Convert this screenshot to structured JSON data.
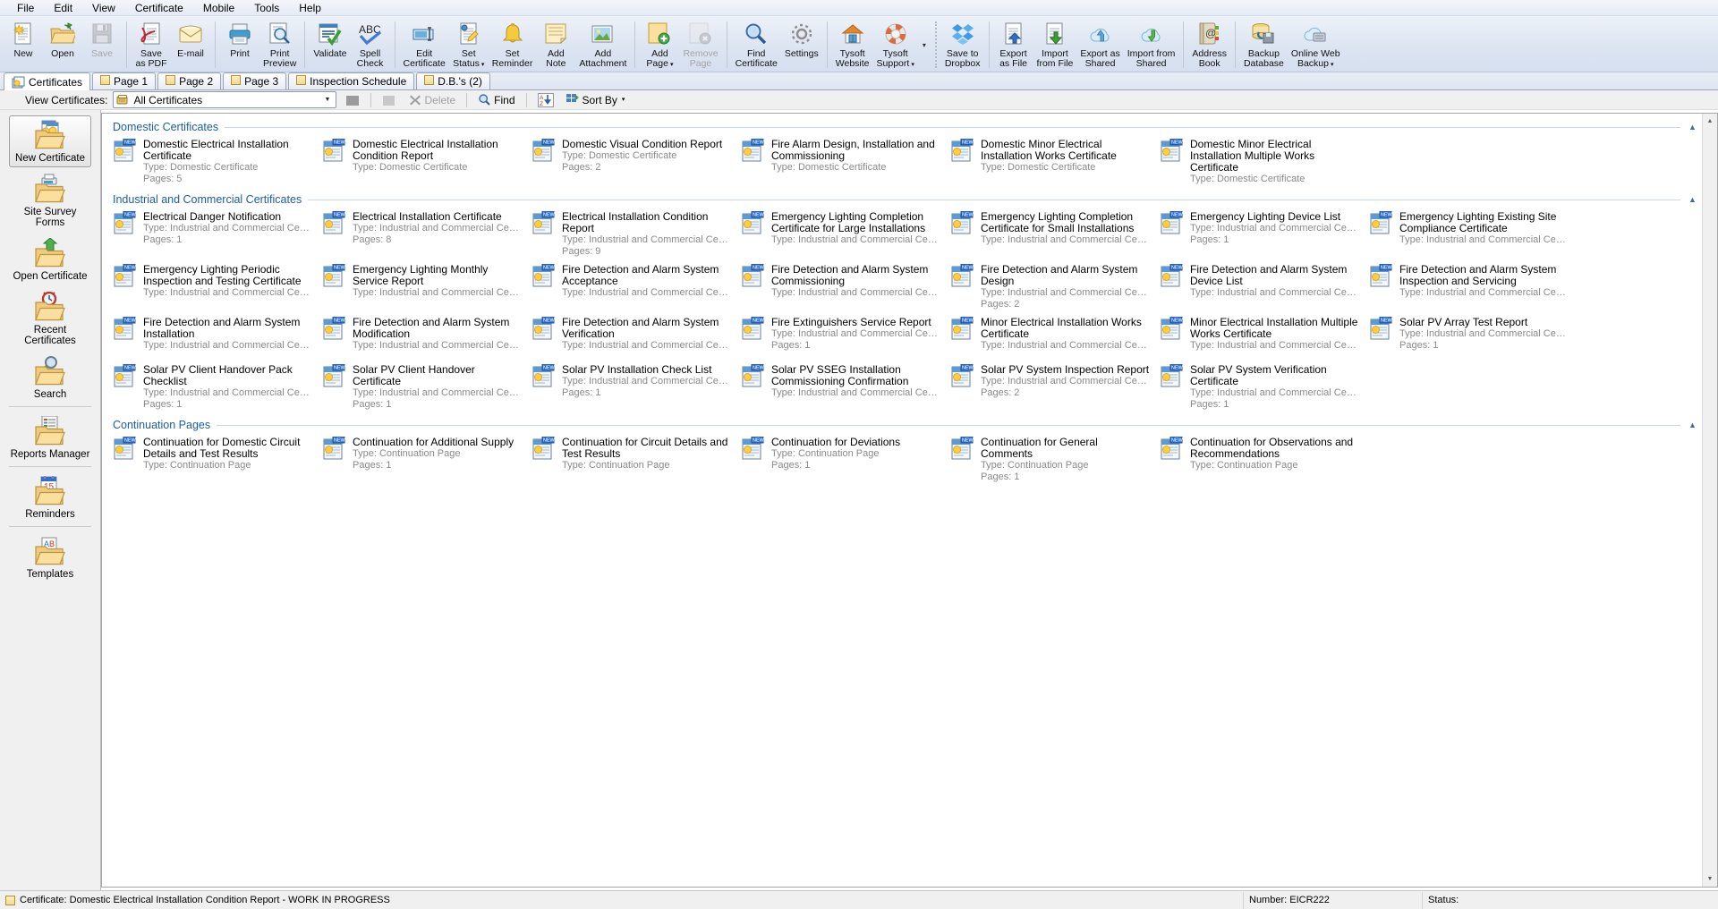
{
  "menu": {
    "items": [
      "File",
      "Edit",
      "View",
      "Certificate",
      "Mobile",
      "Tools",
      "Help"
    ]
  },
  "toolbar": {
    "groups": [
      {
        "buttons": [
          {
            "label": "New",
            "icon": "new-document-icon",
            "disabled": false,
            "dropdown": false
          },
          {
            "label": "Open",
            "icon": "open-folder-icon",
            "disabled": false,
            "dropdown": false
          },
          {
            "label": "Save",
            "icon": "floppy-save-icon",
            "disabled": true,
            "dropdown": false
          }
        ]
      },
      {
        "buttons": [
          {
            "label": "Save\nas PDF",
            "icon": "pdf-icon",
            "disabled": false,
            "dropdown": false
          },
          {
            "label": "E-mail",
            "icon": "envelope-icon",
            "disabled": false,
            "dropdown": false
          }
        ]
      },
      {
        "buttons": [
          {
            "label": "Print",
            "icon": "printer-icon",
            "disabled": false,
            "dropdown": false
          },
          {
            "label": "Print\nPreview",
            "icon": "print-preview-icon",
            "disabled": false,
            "dropdown": false
          }
        ]
      },
      {
        "buttons": [
          {
            "label": "Validate",
            "icon": "validate-checkmark-icon",
            "disabled": false,
            "dropdown": false
          },
          {
            "label": "Spell\nCheck",
            "icon": "spellcheck-abc-icon",
            "disabled": false,
            "dropdown": false
          }
        ]
      },
      {
        "buttons": [
          {
            "label": "Edit\nCertificate",
            "icon": "edit-certificate-icon",
            "disabled": false,
            "dropdown": false
          },
          {
            "label": "Set\nStatus",
            "icon": "set-status-icon",
            "disabled": false,
            "dropdown": true
          },
          {
            "label": "Set\nReminder",
            "icon": "bell-reminder-icon",
            "disabled": false,
            "dropdown": false
          },
          {
            "label": "Add\nNote",
            "icon": "note-icon",
            "disabled": false,
            "dropdown": false
          },
          {
            "label": "Add\nAttachment",
            "icon": "attachment-image-icon",
            "disabled": false,
            "dropdown": false
          }
        ]
      },
      {
        "buttons": [
          {
            "label": "Add\nPage",
            "icon": "add-page-icon",
            "disabled": false,
            "dropdown": true
          },
          {
            "label": "Remove\nPage",
            "icon": "remove-page-icon",
            "disabled": true,
            "dropdown": false
          }
        ]
      },
      {
        "buttons": [
          {
            "label": "Find\nCertificate",
            "icon": "magnifier-icon",
            "disabled": false,
            "dropdown": false
          },
          {
            "label": "Settings",
            "icon": "gear-icon",
            "disabled": false,
            "dropdown": false
          }
        ]
      },
      {
        "buttons": [
          {
            "label": "Tysoft\nWebsite",
            "icon": "home-icon",
            "disabled": false,
            "dropdown": false
          },
          {
            "label": "Tysoft\nSupport",
            "icon": "lifebuoy-icon",
            "disabled": false,
            "dropdown": true
          }
        ]
      },
      {
        "buttons": [
          {
            "label": "Save to\nDropbox",
            "icon": "dropbox-icon",
            "disabled": false,
            "dropdown": false
          }
        ]
      },
      {
        "buttons": [
          {
            "label": "Export\nas File",
            "icon": "export-file-icon",
            "disabled": false,
            "dropdown": false
          },
          {
            "label": "Import\nfrom File",
            "icon": "import-file-icon",
            "disabled": false,
            "dropdown": false
          },
          {
            "label": "Export as\nShared",
            "icon": "cloud-upload-icon",
            "disabled": false,
            "dropdown": false
          },
          {
            "label": "Import from\nShared",
            "icon": "cloud-download-icon",
            "disabled": false,
            "dropdown": false
          }
        ]
      },
      {
        "buttons": [
          {
            "label": "Address\nBook",
            "icon": "address-book-icon",
            "disabled": false,
            "dropdown": false
          }
        ]
      },
      {
        "buttons": [
          {
            "label": "Backup\nDatabase",
            "icon": "backup-database-icon",
            "disabled": false,
            "dropdown": false
          },
          {
            "label": "Online Web\nBackup",
            "icon": "online-backup-icon",
            "disabled": false,
            "dropdown": true
          }
        ]
      }
    ],
    "overflow_caret": "▾"
  },
  "tabs": [
    {
      "label": "Certificates",
      "active": true,
      "icon": "certificates-tab-icon"
    },
    {
      "label": "Page 1",
      "active": false,
      "icon": "page-tab-icon"
    },
    {
      "label": "Page 2",
      "active": false,
      "icon": "page-tab-icon"
    },
    {
      "label": "Page 3",
      "active": false,
      "icon": "page-tab-icon"
    },
    {
      "label": "Inspection Schedule",
      "active": false,
      "icon": "page-tab-icon"
    },
    {
      "label": "D.B.'s (2)",
      "active": false,
      "icon": "page-tab-icon"
    }
  ],
  "filterbar": {
    "view_label": "View Certificates:",
    "combo_value": "All Certificates",
    "combo_icon": "card-index-icon",
    "combo_arrow": "▼",
    "new_folder_label": "",
    "open_folder_label": "",
    "delete_label": "Delete",
    "find_label": "Find",
    "sort_label": "Sort By",
    "sort_caret": "▾"
  },
  "sidebar": {
    "items": [
      {
        "label": "New Certificate",
        "icon": "new-certificate-folder-icon",
        "selected": true,
        "sep_after": false
      },
      {
        "label": "Site Survey Forms",
        "icon": "site-survey-folder-icon",
        "selected": false,
        "sep_after": false
      },
      {
        "label": "Open Certificate",
        "icon": "open-certificate-folder-icon",
        "selected": false,
        "sep_after": false
      },
      {
        "label": "Recent Certificates",
        "icon": "recent-certificates-folder-icon",
        "selected": false,
        "sep_after": false
      },
      {
        "label": "Search",
        "icon": "search-folder-icon",
        "selected": false,
        "sep_after": true
      },
      {
        "label": "Reports Manager",
        "icon": "reports-manager-folder-icon",
        "selected": false,
        "sep_after": true
      },
      {
        "label": "Reminders",
        "icon": "reminders-folder-icon",
        "selected": false,
        "sep_after": true
      },
      {
        "label": "Templates",
        "icon": "templates-folder-icon",
        "selected": false,
        "sep_after": false
      }
    ]
  },
  "content": {
    "groups": [
      {
        "title": "Domestic Certificates",
        "collapse_icon": "▲",
        "items": [
          {
            "title": "Domestic Electrical Installation Certificate",
            "type": "Type: Domestic Certificate",
            "pages": "Pages: 5"
          },
          {
            "title": "Domestic Electrical Installation Condition Report",
            "type": "Type: Domestic Certificate",
            "pages": ""
          },
          {
            "title": "Domestic Visual Condition Report",
            "type": "Type: Domestic Certificate",
            "pages": "Pages: 2"
          },
          {
            "title": "Fire Alarm Design, Installation and Commissioning",
            "type": "Type: Domestic Certificate",
            "pages": ""
          },
          {
            "title": "Domestic Minor Electrical Installation Works Certificate",
            "type": "Type: Domestic Certificate",
            "pages": ""
          },
          {
            "title": "Domestic Minor Electrical Installation Multiple Works Certificate",
            "type": "Type: Domestic Certificate",
            "pages": ""
          }
        ]
      },
      {
        "title": "Industrial and Commercial Certificates",
        "collapse_icon": "▲",
        "items": [
          {
            "title": "Electrical Danger Notification",
            "type": "Type: Industrial and Commercial Certific...",
            "pages": "Pages: 1"
          },
          {
            "title": "Electrical Installation Certificate",
            "type": "Type: Industrial and Commercial Certific...",
            "pages": "Pages: 8"
          },
          {
            "title": "Electrical Installation Condition Report",
            "type": "Type: Industrial and Commercial Certific...",
            "pages": "Pages: 9"
          },
          {
            "title": "Emergency Lighting Completion Certificate for Large Installations",
            "type": "Type: Industrial and Commercial Certific...",
            "pages": ""
          },
          {
            "title": "Emergency Lighting Completion Certificate for Small Installations",
            "type": "Type: Industrial and Commercial Certific...",
            "pages": ""
          },
          {
            "title": "Emergency Lighting Device List",
            "type": "Type: Industrial and Commercial Certific...",
            "pages": "Pages: 1"
          },
          {
            "title": "Emergency Lighting Existing Site Compliance Certificate",
            "type": "Type: Industrial and Commercial Certific...",
            "pages": ""
          },
          {
            "title": "Emergency Lighting Periodic Inspection and Testing Certificate",
            "type": "Type: Industrial and Commercial Certific...",
            "pages": ""
          },
          {
            "title": "Emergency Lighting Monthly Service Report",
            "type": "Type: Industrial and Commercial Certific...",
            "pages": ""
          },
          {
            "title": "Fire Detection and Alarm System Acceptance",
            "type": "Type: Industrial and Commercial Certific...",
            "pages": ""
          },
          {
            "title": "Fire Detection and Alarm System Commissioning",
            "type": "Type: Industrial and Commercial Certific...",
            "pages": ""
          },
          {
            "title": "Fire Detection and Alarm System Design",
            "type": "Type: Industrial and Commercial Certific...",
            "pages": "Pages: 2"
          },
          {
            "title": "Fire Detection and Alarm System Device List",
            "type": "Type: Industrial and Commercial Certific...",
            "pages": ""
          },
          {
            "title": "Fire Detection and Alarm System Inspection and Servicing",
            "type": "Type: Industrial and Commercial Certific...",
            "pages": ""
          },
          {
            "title": "Fire Detection and Alarm System Installation",
            "type": "Type: Industrial and Commercial Certific...",
            "pages": ""
          },
          {
            "title": "Fire Detection and Alarm System Modification",
            "type": "Type: Industrial and Commercial Certific...",
            "pages": ""
          },
          {
            "title": "Fire Detection and Alarm System Verification",
            "type": "Type: Industrial and Commercial Certific...",
            "pages": ""
          },
          {
            "title": "Fire Extinguishers Service Report",
            "type": "Type: Industrial and Commercial Certific...",
            "pages": "Pages: 1"
          },
          {
            "title": "Minor Electrical Installation Works Certificate",
            "type": "Type: Industrial and Commercial Certific...",
            "pages": ""
          },
          {
            "title": "Minor Electrical Installation Multiple Works Certificate",
            "type": "Type: Industrial and Commercial Certific...",
            "pages": ""
          },
          {
            "title": "Solar PV Array Test Report",
            "type": "Type: Industrial and Commercial Certific...",
            "pages": "Pages: 1"
          },
          {
            "title": "Solar PV Client Handover Pack Checklist",
            "type": "Type: Industrial and Commercial Certific...",
            "pages": "Pages: 1"
          },
          {
            "title": "Solar PV Client Handover Certificate",
            "type": "Type: Industrial and Commercial Certific...",
            "pages": "Pages: 1"
          },
          {
            "title": "Solar PV Installation Check List",
            "type": "Type: Industrial and Commercial Certific...",
            "pages": "Pages: 1"
          },
          {
            "title": "Solar PV SSEG Installation Commissioning Confirmation",
            "type": "Type: Industrial and Commercial Certific...",
            "pages": ""
          },
          {
            "title": "Solar PV System Inspection Report",
            "type": "Type: Industrial and Commercial Certific...",
            "pages": "Pages: 2"
          },
          {
            "title": "Solar PV System Verification Certificate",
            "type": "Type: Industrial and Commercial Certific...",
            "pages": "Pages: 1"
          }
        ]
      },
      {
        "title": "Continuation Pages",
        "collapse_icon": "▲",
        "items": [
          {
            "title": "Continuation for Domestic Circuit Details and Test Results",
            "type": "Type: Continuation Page",
            "pages": ""
          },
          {
            "title": "Continuation for Additional Supply",
            "type": "Type: Continuation Page",
            "pages": "Pages: 1"
          },
          {
            "title": "Continuation for Circuit Details and Test Results",
            "type": "Type: Continuation Page",
            "pages": ""
          },
          {
            "title": "Continuation for Deviations",
            "type": "Type: Continuation Page",
            "pages": "Pages: 1"
          },
          {
            "title": "Continuation for General Comments",
            "type": "Type: Continuation Page",
            "pages": "Pages: 1"
          },
          {
            "title": "Continuation for Observations and Recommendations",
            "type": "Type: Continuation Page",
            "pages": ""
          }
        ]
      }
    ],
    "scroll_up": "▲",
    "scroll_down": "▼"
  },
  "statusbar": {
    "certificate": "Certificate: Domestic Electrical Installation Condition Report - WORK IN PROGRESS",
    "number": "Number: EICR222",
    "status": "Status:"
  },
  "colors": {
    "accent_blue": "#1b5ea6",
    "toolbar_top": "#eef2f9",
    "toolbar_bottom": "#d5dff0",
    "muted_text": "#8a8a8a",
    "folder_gold": "#e8c473"
  }
}
